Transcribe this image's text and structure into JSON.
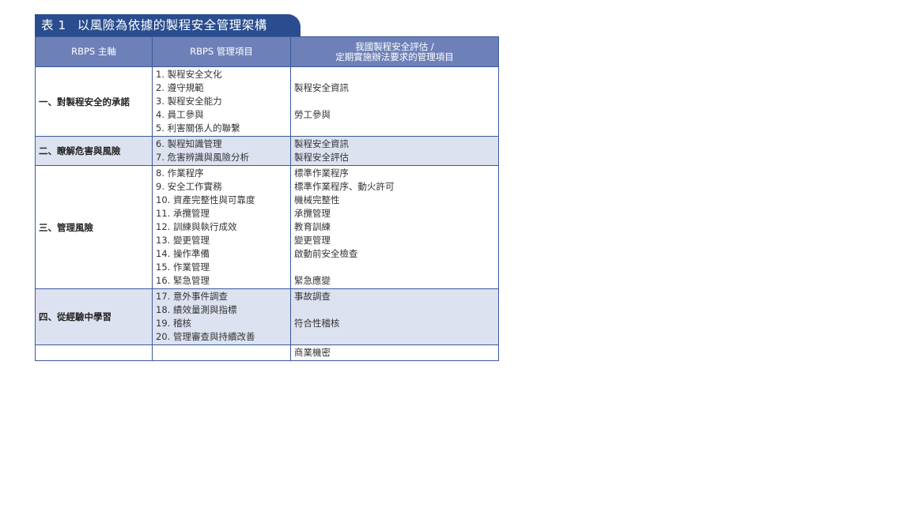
{
  "title": {
    "number": "表 1",
    "text": "以風險為依據的製程安全管理架構"
  },
  "header": {
    "col1": "RBPS 主軸",
    "col2": "RBPS 管理項目",
    "col3_line1": "我國製程安全評估 /",
    "col3_line2": "定期實施辦法要求的管理項目"
  },
  "rows": [
    {
      "theme": "一、對製程安全的承諾",
      "items": [
        "1. 製程安全文化",
        "2. 遵守規範",
        "3. 製程安全能力",
        "4. 員工參與",
        "5. 利害關係人的聯繫"
      ],
      "mapped": [
        "",
        "製程安全資訊",
        "",
        "勞工參與",
        ""
      ]
    },
    {
      "theme": "二、瞭解危害與風險",
      "items": [
        "6. 製程知識管理",
        "7. 危害辨識與風險分析"
      ],
      "mapped": [
        "製程安全資訊",
        "製程安全評估"
      ]
    },
    {
      "theme": "三、管理風險",
      "items": [
        "8. 作業程序",
        "9. 安全工作實務",
        "10. 資產完整性與可靠度",
        "11. 承攬管理",
        "12. 訓練與執行成效",
        "13. 變更管理",
        "14. 操作準備",
        "15. 作業管理",
        "16. 緊急管理"
      ],
      "mapped": [
        "標準作業程序",
        "標準作業程序、動火許可",
        "機械完整性",
        "承攬管理",
        "教育訓練",
        "變更管理",
        "啟動前安全檢查",
        "",
        "緊急應變"
      ]
    },
    {
      "theme": "四、從經驗中學習",
      "items": [
        "17. 意外事件調查",
        "18. 績效量測與指標",
        "19. 稽核",
        "20. 管理審查與持續改善"
      ],
      "mapped": [
        "事故調查",
        "",
        "符合性稽核",
        ""
      ]
    },
    {
      "theme": "",
      "items": [
        ""
      ],
      "mapped": [
        "商業機密"
      ]
    }
  ]
}
